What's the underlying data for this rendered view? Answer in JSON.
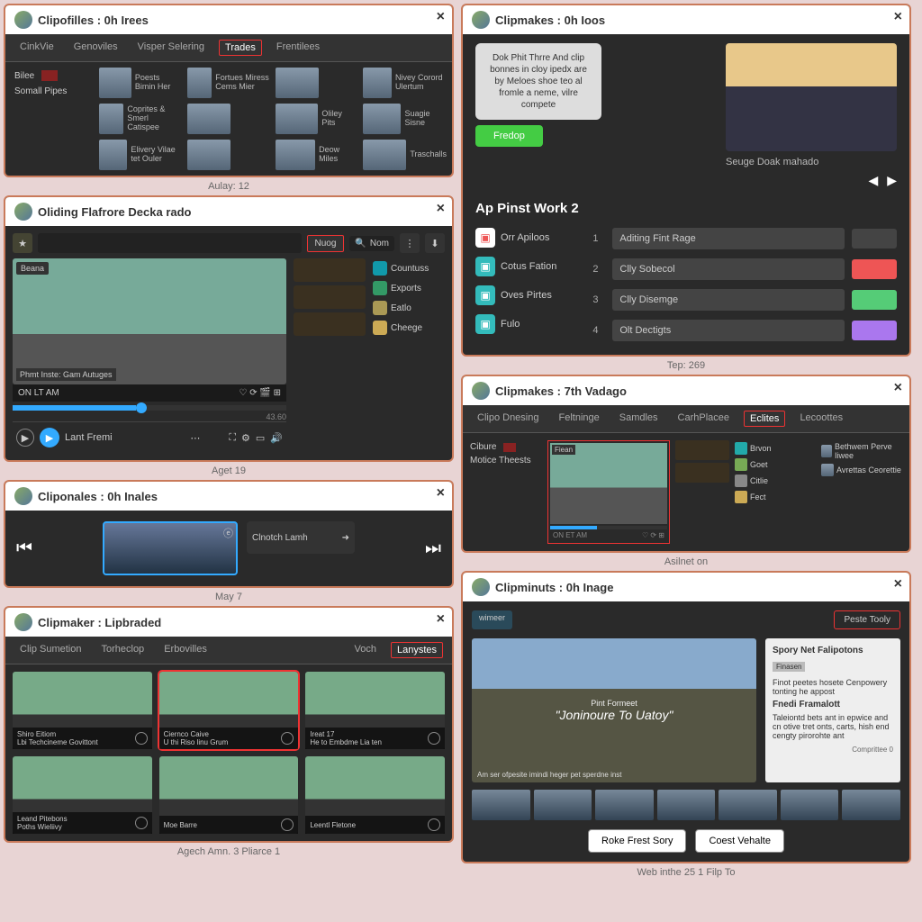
{
  "p1": {
    "title": "Clipofilles : 0h Irees",
    "tabs": [
      "CinkVie",
      "Genoviles",
      "Visper Selering",
      "Trades",
      "Frentilees"
    ],
    "activeTab": 3,
    "side": [
      {
        "label": "Bilee"
      },
      {
        "label": "Somall Pipes"
      }
    ],
    "cells": [
      {
        "label": "Poests Bimin Her"
      },
      {
        "label": "Fortues Miress Cems Mier"
      },
      {
        "label": ""
      },
      {
        "label": "Nivey Corord Ulertum"
      },
      {
        "label": "Coprites & Smerl Catispee"
      },
      {
        "label": ""
      },
      {
        "label": "Oliley Pits"
      },
      {
        "label": "Suagie Sisne"
      },
      {
        "label": "Elivery Vilae tet Ouler"
      },
      {
        "label": ""
      },
      {
        "label": "Deow Miles"
      },
      {
        "label": "Traschalls"
      }
    ],
    "caption": "Aulay: 12"
  },
  "p2": {
    "title": "Clipmakes : 0h Ioos",
    "tooltip": "Dok Phit Thrre And clip bonnes in cloy ipedx are by Meloes shoe teo al fromle a neme, vilre compete",
    "free": "Fredop",
    "preview_caption": "Seuge Doak mahado",
    "section": "Ap Pinst Work 2",
    "list": [
      {
        "icon": "#e55",
        "label": "Orr Apiloos"
      },
      {
        "icon": "#3bb",
        "label": "Cotus Fation"
      },
      {
        "icon": "#3bb",
        "label": "Oves Pirtes"
      },
      {
        "icon": "#3bb",
        "label": "Fulo"
      }
    ],
    "steps": [
      {
        "n": "1",
        "label": "Aditing Fint Rage",
        "color": "#444"
      },
      {
        "n": "2",
        "label": "Clly Sobecol",
        "color": "#e55"
      },
      {
        "n": "3",
        "label": "Clly Disemge",
        "color": "#5c7"
      },
      {
        "n": "4",
        "label": "Olt Dectigts",
        "color": "#a7e"
      }
    ],
    "caption": "Tep: 269"
  },
  "p3": {
    "title": "Oliding Flafrore Decka rado",
    "news_btn": "Nuog",
    "search_ph": "Nom",
    "vid_tag": "Beana",
    "vid_caption": "Phmt Inste: Gam Autuges",
    "ctrl_left": "ON LT AM",
    "time": "43.60",
    "bottom": "Lant Fremi",
    "side2": [
      {
        "c": "#19a",
        "l": "Countuss"
      },
      {
        "c": "#396",
        "l": "Exports"
      },
      {
        "c": "#a95",
        "l": "Eatlo"
      },
      {
        "c": "#ca5",
        "l": "Cheege"
      }
    ],
    "caption": "Aget 19"
  },
  "p4": {
    "title": "Clipmakes : 7th Vadago",
    "tabs": [
      "Clipo Dnesing",
      "Feltninge",
      "Samdles",
      "CarhPlacee",
      "Eclites",
      "Lecoottes"
    ],
    "activeTab": 4,
    "side": [
      {
        "label": "Cibure"
      },
      {
        "label": "Motice Theests"
      }
    ],
    "vid_tag": "Fiean",
    "list": [
      {
        "c": "#2aa",
        "l": "Brvon"
      },
      {
        "c": "#7a5",
        "l": "Goet"
      },
      {
        "c": "#888",
        "l": "Citlie"
      },
      {
        "c": "#ca5",
        "l": "Fect"
      }
    ],
    "right": [
      {
        "l": "Bethwem Perve Iiwee"
      },
      {
        "l": "Avrettas Ceorettie"
      }
    ],
    "caption": "Asilnet on"
  },
  "p5": {
    "title": "Cliponales : 0h Inales",
    "card2": "Clnotch Lamh",
    "caption": "May 7"
  },
  "p6": {
    "title": "Clipmaker : Lipbraded",
    "tabs": [
      "Clip Sumetion",
      "Torheclop",
      "Erbovilles",
      "Voch",
      "Lanystes"
    ],
    "activeTab": 4,
    "cards": [
      {
        "t1": "Shiro Eitiom",
        "t2": "Lbi Techcineme Govittont"
      },
      {
        "t1": "Ciernco Caive",
        "t2": "U thi Riso linu Grum",
        "sel": true
      },
      {
        "t1": "Ireat 17",
        "t2": "He to Embdme Lia ten"
      },
      {
        "t1": "Leand Pitebons",
        "t2": "Poths Wieliivy"
      },
      {
        "t1": "Moe Barre",
        "t2": ""
      },
      {
        "t1": "Leentl Fletone",
        "t2": ""
      }
    ],
    "caption": "Agech Amn. 3 Pliarce 1"
  },
  "p7": {
    "title": "Clipminuts : 0h Inage",
    "chip": "wimeer",
    "redbtn": "Peste Tooly",
    "img_sub": "Pint Formeet",
    "img_title": "\"Joninoure To Uatoy\"",
    "img_foot": "Am ser ofpesite imindi heger pet sperdne inst",
    "side_h": "Spory Net Falipotons",
    "side_tag": "Finasen",
    "side_p1": "Finot peetes hosete Cenpowery tonting he appost",
    "side_h2": "Fnedi Framalott",
    "side_p2": "Taleiontd bets ant in epwice and cn otive tret onts, carts, hish end cengty pirorohte ant",
    "side_foot": "Comprittee 0",
    "btn1": "Roke Frest Sory",
    "btn2": "Coest Vehalte",
    "caption": "Web inthe 25 1 Filp To"
  }
}
